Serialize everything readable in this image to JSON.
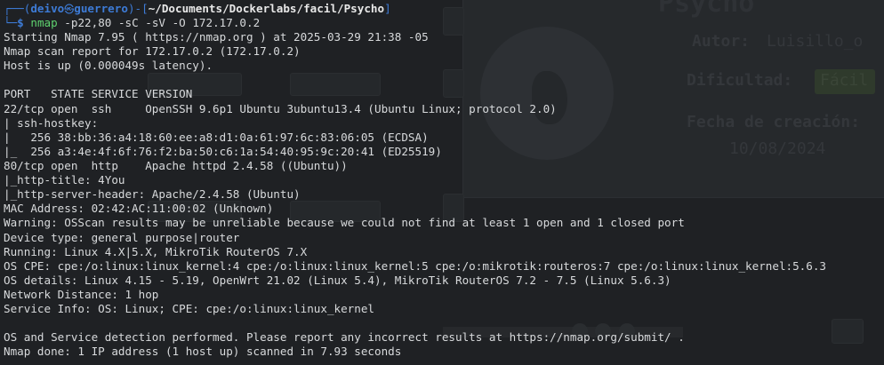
{
  "prompt": {
    "bracket_open": "┌──(",
    "user": "deivo",
    "user_symbol": "㉿",
    "host": "guerrero",
    "bracket_mid": ")-[",
    "path": "~/Documents/Dockerlabs/facil/Psycho",
    "bracket_close": "]",
    "corner_bottom": "└─",
    "dollar": "$",
    "command": "nmap",
    "args": " -p22,80 -sC -sV -O 172.17.0.2"
  },
  "output": [
    "Starting Nmap 7.95 ( https://nmap.org ) at 2025-03-29 21:38 -05",
    "Nmap scan report for 172.17.0.2 (172.17.0.2)",
    "Host is up (0.000049s latency).",
    "",
    "PORT   STATE SERVICE VERSION",
    "22/tcp open  ssh     OpenSSH 9.6p1 Ubuntu 3ubuntu13.4 (Ubuntu Linux; protocol 2.0)",
    "| ssh-hostkey: ",
    "|   256 38:bb:36:a4:18:60:ee:a8:d1:0a:61:97:6c:83:06:05 (ECDSA)",
    "|_  256 a3:4e:4f:6f:76:f2:ba:50:c6:1a:54:40:95:9c:20:41 (ED25519)",
    "80/tcp open  http    Apache httpd 2.4.58 ((Ubuntu))",
    "|_http-title: 4You",
    "|_http-server-header: Apache/2.4.58 (Ubuntu)",
    "MAC Address: 02:42:AC:11:00:02 (Unknown)",
    "Warning: OSScan results may be unreliable because we could not find at least 1 open and 1 closed port",
    "Device type: general purpose|router",
    "Running: Linux 4.X|5.X, MikroTik RouterOS 7.X",
    "OS CPE: cpe:/o:linux:linux_kernel:4 cpe:/o:linux:linux_kernel:5 cpe:/o:mikrotik:routeros:7 cpe:/o:linux:linux_kernel:5.6.3",
    "OS details: Linux 4.15 - 5.19, OpenWrt 21.02 (Linux 5.4), MikroTik RouterOS 7.2 - 7.5 (Linux 5.6.3)",
    "Network Distance: 1 hop",
    "Service Info: OS: Linux; CPE: cpe:/o:linux:linux_kernel",
    "",
    "OS and Service detection performed. Please report any incorrect results at https://nmap.org/submit/ .",
    "Nmap done: 1 IP address (1 host up) scanned in 7.93 seconds"
  ],
  "background_window": {
    "title": "Psycho",
    "author_label": "Autor:",
    "author_value": "Luisillo_o",
    "difficulty_label": "Dificultad:",
    "difficulty_value": "Fácil",
    "date_label": "Fecha de creación:",
    "date_value": "10/08/2024"
  },
  "colors": {
    "background": "#1f2124",
    "prompt_accent": "#3d7bd6",
    "command": "#5fd26f",
    "text": "#d8dadc"
  }
}
